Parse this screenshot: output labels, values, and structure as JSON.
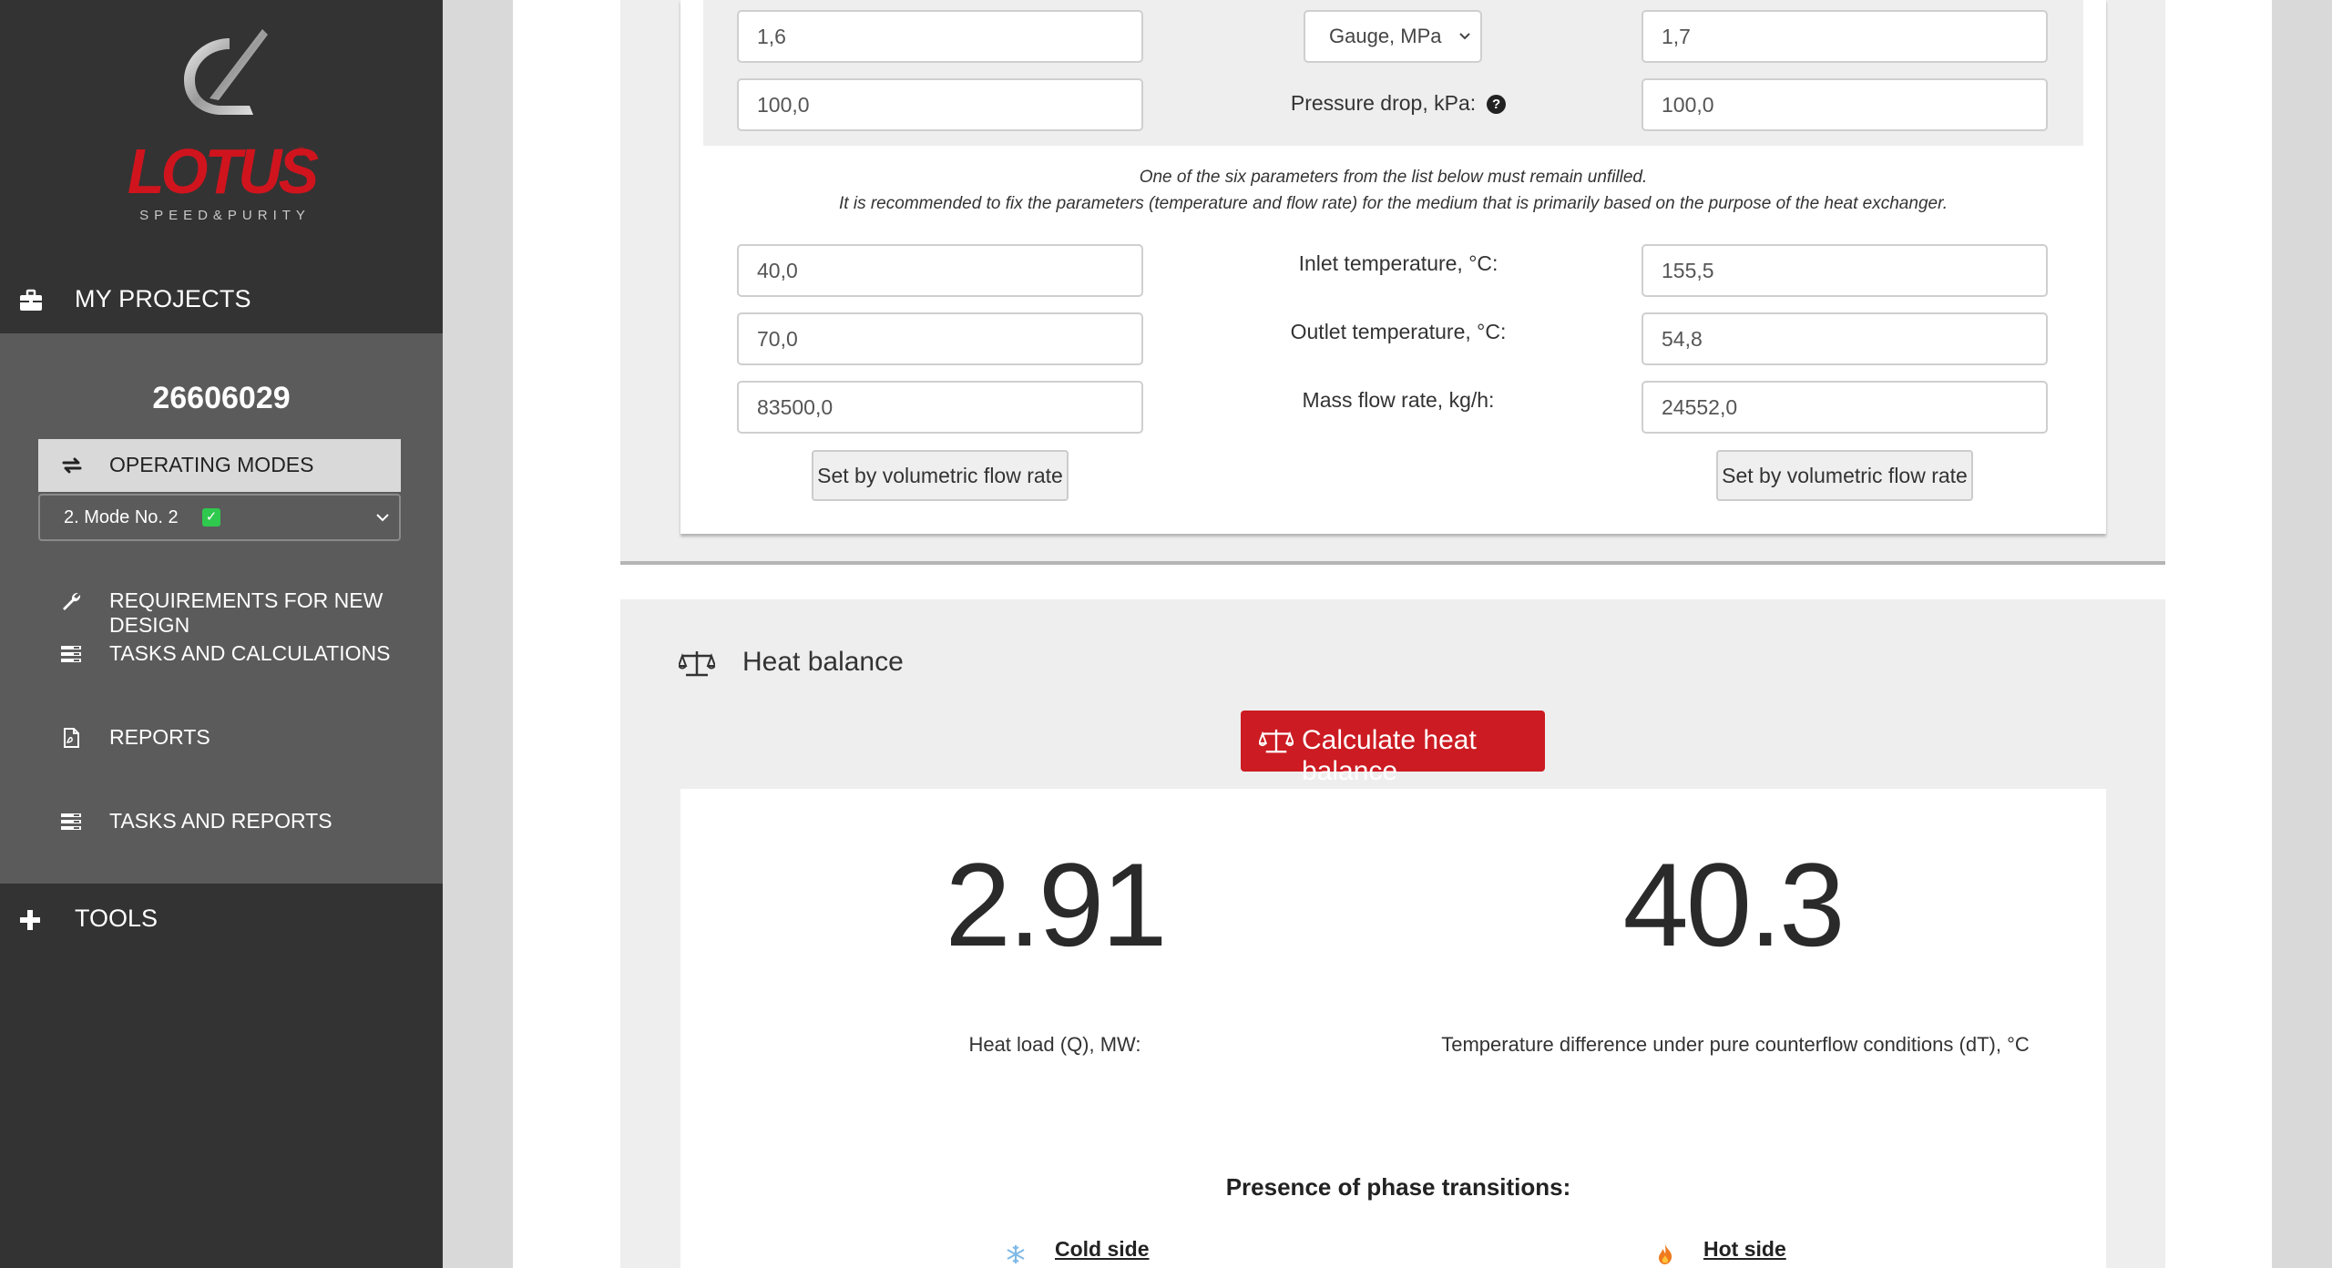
{
  "sidebar": {
    "logo": {
      "brand": "LOTUS",
      "tagline": "SPEED&PURITY",
      "registered": "®"
    },
    "my_projects": "MY PROJECTS",
    "project_id": "26606029",
    "operating_modes": "OPERATING MODES",
    "mode_select": {
      "value": "2. Mode No. 2",
      "check": "✓"
    },
    "items": [
      {
        "label": "REQUIREMENTS FOR NEW DESIGN",
        "icon": "wrench-icon"
      },
      {
        "label": "TASKS AND CALCULATIONS",
        "icon": "list-icon"
      },
      {
        "label": "REPORTS",
        "icon": "pdf-file-icon"
      },
      {
        "label": "TASKS AND REPORTS",
        "icon": "list-icon"
      }
    ],
    "tools": "TOOLS"
  },
  "form": {
    "row1": {
      "left": "1,6",
      "unit_select": "Gauge, MPa",
      "right": "1,7"
    },
    "row2": {
      "left": "100,0",
      "label": "Pressure drop, kPa:",
      "help": "?",
      "right": "100,0"
    },
    "note_line1": "One of the six parameters from the list below must remain unfilled.",
    "note_line2": "It is recommended to fix the parameters (temperature and flow rate) for the medium that is primarily based on the purpose of the heat exchanger.",
    "inlet": {
      "left": "40,0",
      "label": "Inlet temperature, °C:",
      "right": "155,5"
    },
    "outlet": {
      "left": "70,0",
      "label": "Outlet temperature, °C:",
      "right": "54,8"
    },
    "mass_flow": {
      "left": "83500,0",
      "label": "Mass flow rate, kg/h:",
      "right": "24552,0"
    },
    "vol_button_left": "Set by volumetric flow rate",
    "vol_button_right": "Set by volumetric flow rate"
  },
  "heat_balance": {
    "title": "Heat balance",
    "calc_button": "Calculate heat balance",
    "heat_load_value": "2.91",
    "heat_load_label": "Heat load (Q), MW:",
    "temp_diff_value": "40.3",
    "temp_diff_label": "Temperature difference under pure counterflow conditions (dT), °C",
    "phase_title": "Presence of phase transitions:",
    "cold_side": "Cold side",
    "hot_side": "Hot side"
  },
  "colors": {
    "brand_red": "#cc1b22",
    "sidebar_dark": "#333333",
    "sidebar_panel": "#5b5b5b",
    "check_green": "#2fc94e"
  }
}
